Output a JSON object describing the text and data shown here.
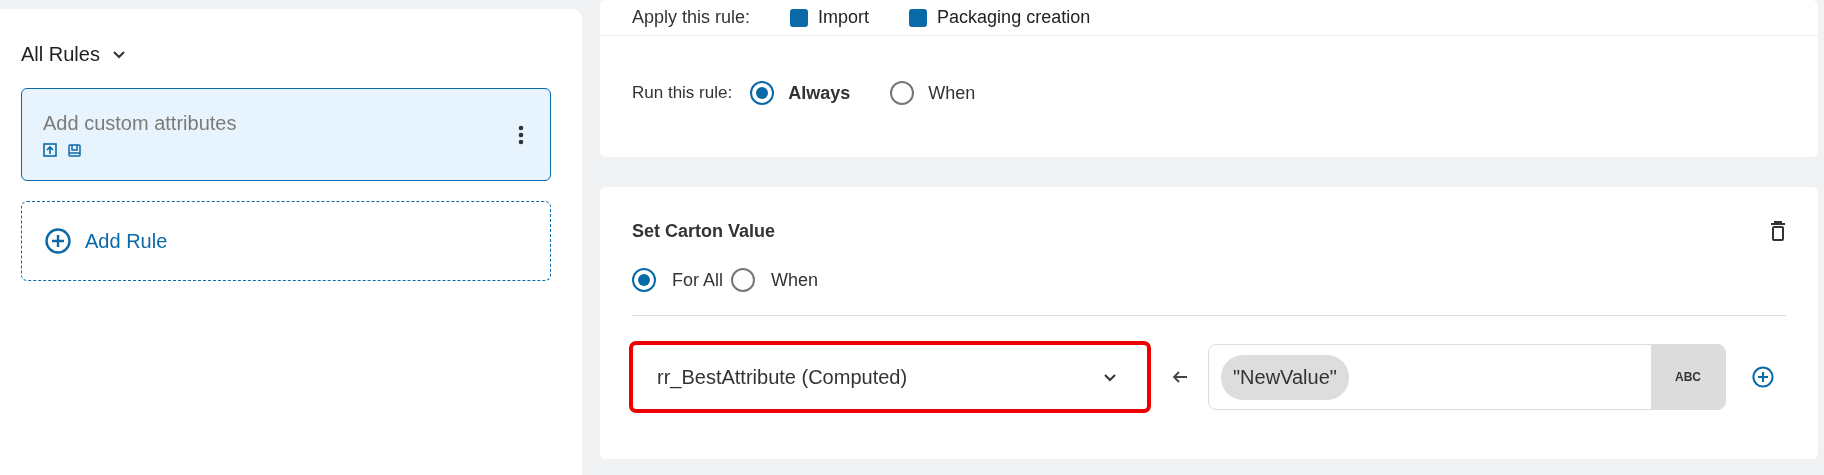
{
  "sidebar": {
    "heading": "All Rules",
    "rules": [
      {
        "title": "Add custom attributes",
        "selected": true
      }
    ],
    "add_button": "Add Rule"
  },
  "rule": {
    "apply": {
      "label": "Apply this rule:",
      "options": [
        {
          "label": "Import",
          "checked": true
        },
        {
          "label": "Packaging creation",
          "checked": true
        }
      ]
    },
    "run": {
      "label": "Run this rule:",
      "options": [
        {
          "label": "Always",
          "selected": true
        },
        {
          "label": "When",
          "selected": false
        }
      ]
    }
  },
  "action": {
    "title": "Set Carton Value",
    "scope": [
      {
        "label": "For All",
        "selected": true
      },
      {
        "label": "When",
        "selected": false
      }
    ],
    "target": {
      "value": "rr_BestAttribute (Computed)",
      "highlighted": true
    },
    "value_chip": "\"NewValue\"",
    "type_badge": "ABC"
  }
}
